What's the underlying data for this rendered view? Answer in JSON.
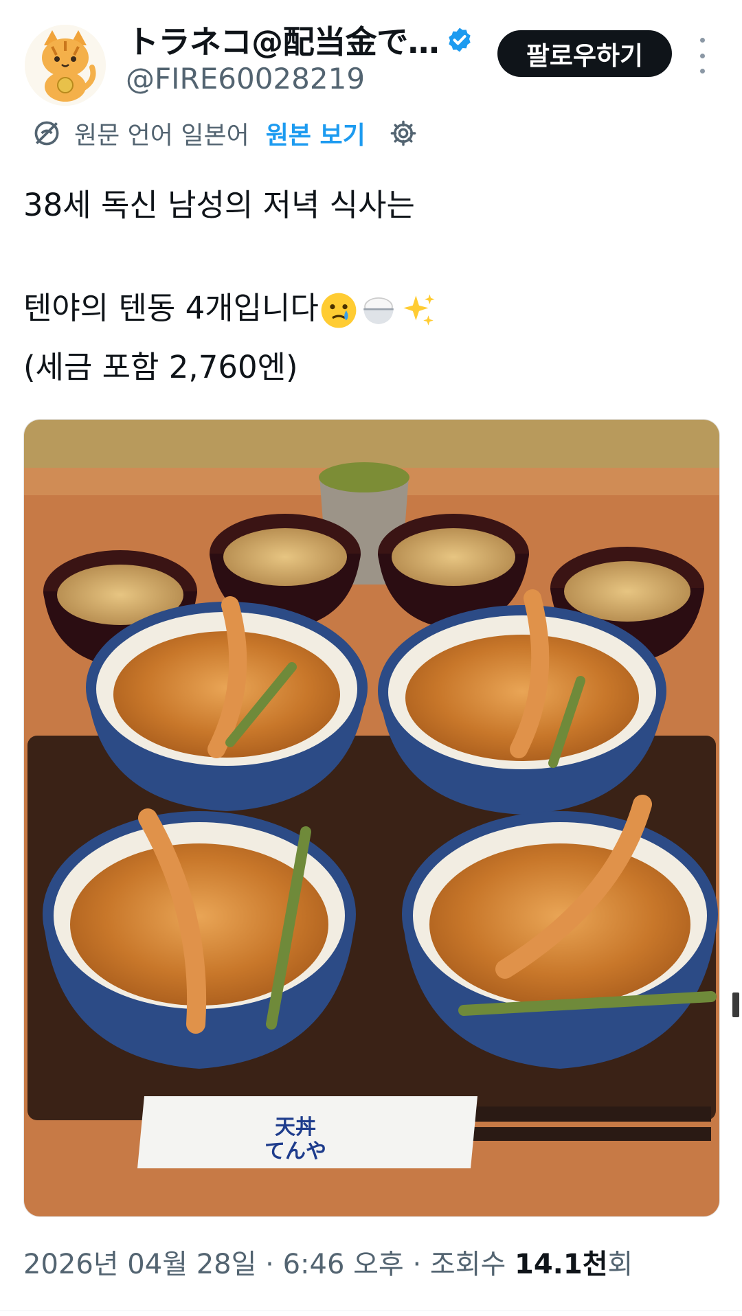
{
  "author": {
    "display_name": "トラネコ@配当金で…",
    "handle": "@FIRE60028219",
    "verified": true,
    "avatar": "cat-avatar"
  },
  "follow_label": "팔로우하기",
  "translation": {
    "text": "원문 언어 일본어",
    "link": "원본 보기"
  },
  "tweet": {
    "line1": "38세 독신 남성의 저녁 식사는",
    "line2": "텐야의 텐동 4개입니다",
    "line2_emojis": [
      "crying-face-emoji",
      "rice-bowl-emoji",
      "sparkles-emoji"
    ],
    "line3": "(세금 포함 2,760엔)"
  },
  "photo": {
    "description_icon": "tendon-photo",
    "wrapper_logo_line1": "天丼",
    "wrapper_logo_line2": "てんや"
  },
  "meta": {
    "date": "2026년 04월 28일",
    "time": "6:46 오후",
    "views_prefix": "조회수",
    "views_count": "14.1천",
    "views_suffix": "회"
  },
  "colors": {
    "link": "#1d9bf0",
    "verified": "#1d9bf0",
    "follow_bg": "#0f1419",
    "secondary_text": "#536471"
  }
}
